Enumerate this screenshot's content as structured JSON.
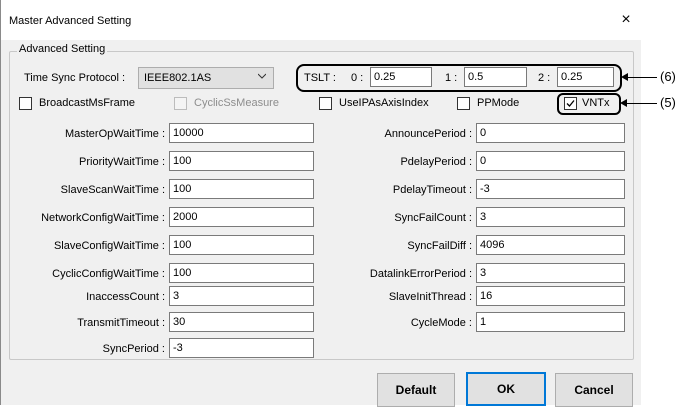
{
  "window": {
    "title": "Master Advanced Setting",
    "close_glyph": "×"
  },
  "group": {
    "label": "Advanced Setting"
  },
  "time_sync": {
    "label": "Time Sync Protocol :",
    "value": "IEEE802.1AS"
  },
  "tslt": {
    "label": "TSLT :",
    "fields": [
      {
        "label": "0 :",
        "value": "0.25"
      },
      {
        "label": "1 :",
        "value": "0.5"
      },
      {
        "label": "2 :",
        "value": "0.25"
      }
    ]
  },
  "checkboxes": [
    {
      "label": "BroadcastMsFrame",
      "checked": false,
      "disabled": false
    },
    {
      "label": "CyclicSsMeasure",
      "checked": false,
      "disabled": true
    },
    {
      "label": "UseIPAsAxisIndex",
      "checked": false,
      "disabled": false
    },
    {
      "label": "PPMode",
      "checked": false,
      "disabled": false
    },
    {
      "label": "VNTx",
      "checked": true,
      "disabled": false
    }
  ],
  "left_fields": [
    {
      "label": "MasterOpWaitTime :",
      "value": "10000"
    },
    {
      "label": "PriorityWaitTime :",
      "value": "100"
    },
    {
      "label": "SlaveScanWaitTime :",
      "value": "100"
    },
    {
      "label": "NetworkConfigWaitTime :",
      "value": "2000"
    },
    {
      "label": "SlaveConfigWaitTime :",
      "value": "100"
    },
    {
      "label": "CyclicConfigWaitTime :",
      "value": "100"
    },
    {
      "label": "InaccessCount :",
      "value": "3"
    },
    {
      "label": "TransmitTimeout :",
      "value": "30"
    },
    {
      "label": "SyncPeriod :",
      "value": "-3"
    }
  ],
  "right_fields": [
    {
      "label": "AnnouncePeriod :",
      "value": "0"
    },
    {
      "label": "PdelayPeriod :",
      "value": "0"
    },
    {
      "label": "PdelayTimeout :",
      "value": "-3"
    },
    {
      "label": "SyncFailCount :",
      "value": "3"
    },
    {
      "label": "SyncFailDiff :",
      "value": "4096"
    },
    {
      "label": "DatalinkErrorPeriod :",
      "value": "3"
    },
    {
      "label": "SlaveInitThread :",
      "value": "16"
    },
    {
      "label": "CycleMode :",
      "value": "1"
    }
  ],
  "buttons": {
    "default": "Default",
    "ok": "OK",
    "cancel": "Cancel"
  },
  "callouts": {
    "tslt": "(6)",
    "vntx": "(5)"
  },
  "icons": {
    "close": "close-icon",
    "dropdown": "chevron-down-icon",
    "check": "checkmark-icon"
  }
}
